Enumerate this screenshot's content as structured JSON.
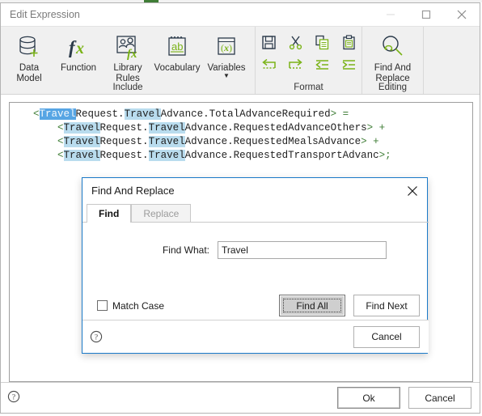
{
  "window": {
    "title": "Edit Expression",
    "controls": {
      "minimize": "minimize-icon",
      "maximize": "maximize-icon",
      "close": "close-icon"
    }
  },
  "ribbon": {
    "groups": [
      {
        "label": "Include",
        "buttons": [
          {
            "label_line1": "Data",
            "label_line2": "Model",
            "icon": "database-plus-icon",
            "has_caret": false
          },
          {
            "label_line1": "Function",
            "label_line2": "",
            "icon": "fx-icon",
            "has_caret": false
          },
          {
            "label_line1": "Library",
            "label_line2": "Rules",
            "icon": "library-rules-icon",
            "has_caret": false
          },
          {
            "label_line1": "Vocabulary",
            "label_line2": "",
            "icon": "vocabulary-icon",
            "has_caret": false
          },
          {
            "label_line1": "Variables",
            "label_line2": "",
            "icon": "variables-icon",
            "has_caret": true
          }
        ]
      },
      {
        "label": "Format",
        "icons": [
          "save-icon",
          "cut-icon",
          "copy-icon",
          "paste-icon",
          "undo-icon",
          "redo-icon",
          "decrease-indent-icon",
          "increase-indent-icon"
        ]
      },
      {
        "label": "Editing",
        "buttons": [
          {
            "label_line1": "Find And",
            "label_line2": "Replace",
            "icon": "find-replace-icon",
            "has_caret": false
          }
        ]
      }
    ]
  },
  "editor": {
    "lines": [
      {
        "indent": 0,
        "parts": [
          {
            "t": "<",
            "style": "tag"
          },
          {
            "t": "Travel",
            "style": "hl-active"
          },
          {
            "t": "Request.",
            "style": "plain"
          },
          {
            "t": "Travel",
            "style": "hl"
          },
          {
            "t": "Advance.TotalAdvanceRequired",
            "style": "plain"
          },
          {
            "t": ">",
            "style": "tag"
          },
          {
            "t": " ",
            "style": "plain"
          },
          {
            "t": "=",
            "style": "op"
          }
        ]
      },
      {
        "indent": 1,
        "parts": [
          {
            "t": "<",
            "style": "tag"
          },
          {
            "t": "Travel",
            "style": "hl"
          },
          {
            "t": "Request.",
            "style": "plain"
          },
          {
            "t": "Travel",
            "style": "hl"
          },
          {
            "t": "Advance.RequestedAdvanceOthers",
            "style": "plain"
          },
          {
            "t": ">",
            "style": "tag"
          },
          {
            "t": " ",
            "style": "plain"
          },
          {
            "t": "+",
            "style": "op"
          }
        ]
      },
      {
        "indent": 1,
        "parts": [
          {
            "t": "<",
            "style": "tag"
          },
          {
            "t": "Travel",
            "style": "hl"
          },
          {
            "t": "Request.",
            "style": "plain"
          },
          {
            "t": "Travel",
            "style": "hl"
          },
          {
            "t": "Advance.RequestedMealsAdvance",
            "style": "plain"
          },
          {
            "t": ">",
            "style": "tag"
          },
          {
            "t": " ",
            "style": "plain"
          },
          {
            "t": "+",
            "style": "op"
          }
        ]
      },
      {
        "indent": 1,
        "parts": [
          {
            "t": "<",
            "style": "tag"
          },
          {
            "t": "Travel",
            "style": "hl"
          },
          {
            "t": "Request.",
            "style": "plain"
          },
          {
            "t": "Travel",
            "style": "hl"
          },
          {
            "t": "Advance.RequestedTransportAdvanc",
            "style": "plain"
          },
          {
            "t": ">;",
            "style": "tag"
          }
        ]
      }
    ]
  },
  "bottom_bar": {
    "help_icon": "help-icon",
    "ok_label": "Ok",
    "cancel_label": "Cancel"
  },
  "find_replace_dialog": {
    "title": "Find And Replace",
    "close_icon": "close-icon",
    "tabs": [
      {
        "label": "Find",
        "active": true
      },
      {
        "label": "Replace",
        "active": false
      }
    ],
    "find_what_label": "Find What:",
    "find_what_value": "Travel",
    "find_what_placeholder": "",
    "match_case_label": "Match Case",
    "match_case_checked": false,
    "find_all_label": "Find All",
    "find_next_label": "Find Next",
    "cancel_label": "Cancel",
    "help_icon": "help-icon"
  },
  "colors": {
    "accent_green": "#3f7d36",
    "dialog_border_blue": "#1a79c8",
    "highlight_active": "#57a5e4",
    "highlight_match": "#b9dcee",
    "ribbon_bg": "#f0f0f0"
  }
}
